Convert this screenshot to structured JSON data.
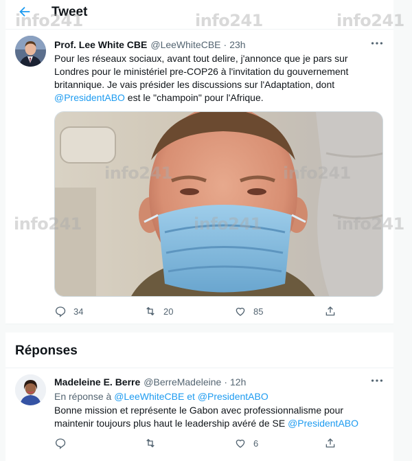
{
  "header": {
    "title": "Tweet"
  },
  "tweet": {
    "author_name": "Prof. Lee White CBE",
    "author_handle": "@LeeWhiteCBE",
    "separator": "·",
    "time": "23h",
    "text_part1": "Pour les réseaux sociaux, avant tout delire, j'annonce que je pars sur Londres pour le ministériel pre-COP26 à l'invitation du gouvernement britannique. Je vais présider les discussions sur l'Adaptation, dont ",
    "mention": "@PresidentABO",
    "text_part2": " est le \"champoin\" pour l'Afrique.",
    "stats": {
      "replies": "34",
      "retweets": "20",
      "likes": "85"
    }
  },
  "replies_section": {
    "title": "Réponses"
  },
  "reply": {
    "author_name": "Madeleine E. Berre",
    "author_handle": "@BerreMadeleine",
    "separator": "·",
    "time": "12h",
    "in_reply_prefix": "En réponse à",
    "in_reply_to_1": "@LeeWhiteCBE",
    "in_reply_and": "et",
    "in_reply_to_2": "@PresidentABO",
    "text": "Bonne mission et représente le Gabon avec professionnalisme pour maintenir toujours plus haut le leadership avéré de SE ",
    "text_mention": "@PresidentABO",
    "stats": {
      "replies": "",
      "retweets": "",
      "likes": "6"
    }
  },
  "watermark": {
    "text": "info",
    "number": "241"
  },
  "colors": {
    "accent": "#1d9bf0",
    "text": "#0f1419",
    "muted": "#536471"
  },
  "icons": [
    "back-arrow-icon",
    "more-icon",
    "reply-icon",
    "retweet-icon",
    "like-icon",
    "share-icon"
  ]
}
